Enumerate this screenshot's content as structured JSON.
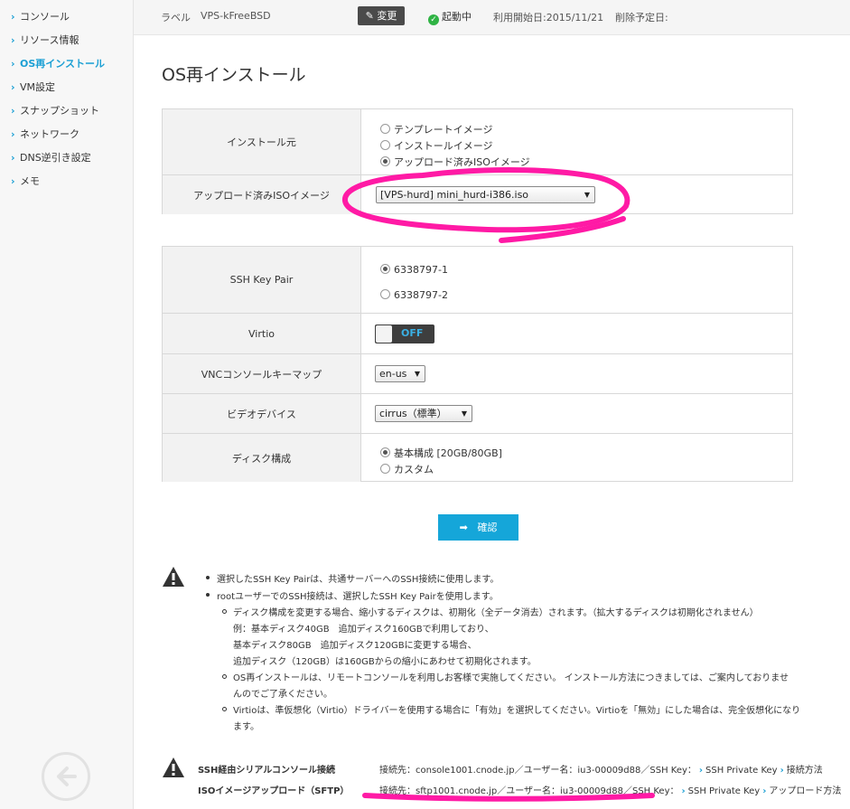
{
  "sidebar": {
    "items": [
      {
        "label": "コンソール",
        "active": false
      },
      {
        "label": "リソース情報",
        "active": false
      },
      {
        "label": "OS再インストール",
        "active": true
      },
      {
        "label": "VM設定",
        "active": false
      },
      {
        "label": "スナップショット",
        "active": false
      },
      {
        "label": "ネットワーク",
        "active": false
      },
      {
        "label": "DNS逆引き設定",
        "active": false
      },
      {
        "label": "メモ",
        "active": false
      }
    ],
    "back_icon": "arrow-left-circle-icon"
  },
  "topbar": {
    "label_caption": "ラベル",
    "label_value": "VPS-kFreeBSD",
    "edit_label": "変更",
    "status": "起動中",
    "start_date": "利用開始日:2015/11/21",
    "delete_date": "削除予定日:"
  },
  "page_title": "OS再インストール",
  "install": {
    "source_label": "インストール元",
    "options": [
      "テンプレートイメージ",
      "インストールイメージ",
      "アップロード済みISOイメージ"
    ],
    "selected_index": 2,
    "iso_label": "アップロード済みISOイメージ",
    "iso_value": "[VPS-hurd] mini_hurd-i386.iso"
  },
  "settings": {
    "ssh_label": "SSH Key Pair",
    "ssh_options": [
      "6338797-1",
      "6338797-2"
    ],
    "virtio_label": "Virtio",
    "virtio_state": "OFF",
    "vnc_label": "VNCコンソールキーマップ",
    "vnc_value": "en-us",
    "video_label": "ビデオデバイス",
    "video_value": "cirrus（標準）",
    "disk_label": "ディスク構成",
    "disk_options": [
      "基本構成 [20GB/80GB]",
      "カスタム"
    ]
  },
  "confirm_label": "確認",
  "notes": {
    "b1": "選択したSSH Key Pairは、共通サーバーへのSSH接続に使用します。",
    "b2": "rootユーザーでのSSH接続は、選択したSSH Key Pairを使用します。",
    "s1": "ディスク構成を変更する場合、縮小するディスクは、初期化（全データ消去）されます。（拡大するディスクは初期化されません）",
    "s1a": "例：基本ディスク40GB　追加ディスク160GBで利用しており、",
    "s1b": "基本ディスク80GB　追加ディスク120GBに変更する場合、",
    "s1c": "追加ディスク（120GB）は160GBからの縮小にあわせて初期化されます。",
    "s2a": "OS再インストールは、リモートコンソールを利用しお客様で実施してください。 インストール方法につきましては、ご案内しておりませ",
    "s2b": "んのでご了承ください。",
    "s3a": "Virtioは、準仮想化（Virtio）ドライバーを使用する場合に「有効」を選択してください。Virtioを「無効」にした場合は、完全仮想化になり",
    "s3b": "ます。"
  },
  "connections": {
    "ssh_title": "SSH経由シリアルコンソール接続",
    "ssh_info": "接続先：console1001.cnode.jp／ユーザー名：iu3-00009d88／SSH Key：",
    "ssh_link1": "SSH Private Key",
    "ssh_link2": "接続方法",
    "sftp_title": "ISOイメージアップロード（SFTP）",
    "sftp_info": "接続先：sftp1001.cnode.jp／ユーザー名：iu3-00009d88／SSH Key：",
    "sftp_link1": "SSH Private Key",
    "sftp_link2": "アップロード方法"
  },
  "colors": {
    "accent": "#1a9fd4",
    "annotation": "#ff1aa5",
    "ok": "#2fb344"
  }
}
